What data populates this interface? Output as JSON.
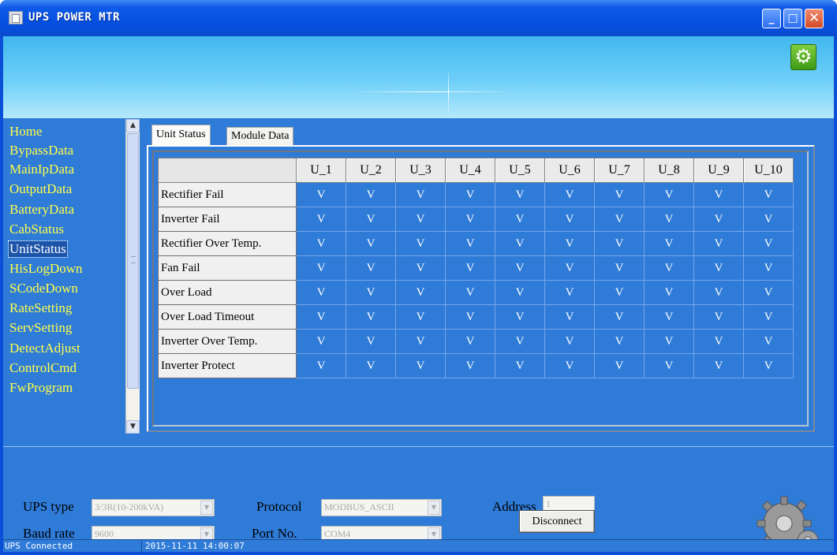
{
  "window": {
    "title": "UPS POWER MTR",
    "controls": {
      "minimize": "_",
      "maximize": "□",
      "close": "✕"
    }
  },
  "banner": {
    "settings_icon": "gear-icon"
  },
  "sidebar": {
    "items": [
      {
        "label": "Home",
        "selected": false
      },
      {
        "label": "BypassData",
        "selected": false
      },
      {
        "label": "MainIpData",
        "selected": false
      },
      {
        "label": "OutputData",
        "selected": false
      },
      {
        "label": "BatteryData",
        "selected": false
      },
      {
        "label": "CabStatus",
        "selected": false
      },
      {
        "label": "UnitStatus",
        "selected": true
      },
      {
        "label": "HisLogDown",
        "selected": false
      },
      {
        "label": "SCodeDown",
        "selected": false
      },
      {
        "label": "RateSetting",
        "selected": false
      },
      {
        "label": "ServSetting",
        "selected": false
      },
      {
        "label": "DetectAdjust",
        "selected": false
      },
      {
        "label": "ControlCmd",
        "selected": false
      },
      {
        "label": "FwProgram",
        "selected": false
      }
    ]
  },
  "tabs": [
    {
      "label": "Unit Status",
      "active": true
    },
    {
      "label": "Module Data",
      "active": false
    }
  ],
  "unit_table": {
    "columns": [
      "U_1",
      "U_2",
      "U_3",
      "U_4",
      "U_5",
      "U_6",
      "U_7",
      "U_8",
      "U_9",
      "U_10"
    ],
    "rows": [
      {
        "label": "Rectifier Fail",
        "values": [
          "V",
          "V",
          "V",
          "V",
          "V",
          "V",
          "V",
          "V",
          "V",
          "V"
        ]
      },
      {
        "label": "Inverter Fail",
        "values": [
          "V",
          "V",
          "V",
          "V",
          "V",
          "V",
          "V",
          "V",
          "V",
          "V"
        ]
      },
      {
        "label": "Rectifier Over Temp.",
        "values": [
          "V",
          "V",
          "V",
          "V",
          "V",
          "V",
          "V",
          "V",
          "V",
          "V"
        ]
      },
      {
        "label": "Fan Fail",
        "values": [
          "V",
          "V",
          "V",
          "V",
          "V",
          "V",
          "V",
          "V",
          "V",
          "V"
        ]
      },
      {
        "label": "Over Load",
        "values": [
          "V",
          "V",
          "V",
          "V",
          "V",
          "V",
          "V",
          "V",
          "V",
          "V"
        ]
      },
      {
        "label": "Over Load Timeout",
        "values": [
          "V",
          "V",
          "V",
          "V",
          "V",
          "V",
          "V",
          "V",
          "V",
          "V"
        ]
      },
      {
        "label": "Inverter Over Temp.",
        "values": [
          "V",
          "V",
          "V",
          "V",
          "V",
          "V",
          "V",
          "V",
          "V",
          "V"
        ]
      },
      {
        "label": "Inverter Protect",
        "values": [
          "V",
          "V",
          "V",
          "V",
          "V",
          "V",
          "V",
          "V",
          "V",
          "V"
        ]
      }
    ]
  },
  "settings": {
    "ups_type_label": "UPS type",
    "ups_type_value": "3/3R(10-200kVA)",
    "baud_rate_label": "Baud rate",
    "baud_rate_value": "9600",
    "protocol_label": "Protocol",
    "protocol_value": "MODBUS_ASCII",
    "port_label": "Port No.",
    "port_value": "COM4",
    "address_label": "Address",
    "address_value": "1",
    "disconnect_label": "Disconnect"
  },
  "status_bar": {
    "connection": "UPS Connected",
    "timestamp": "2015-11-11 14:00:07"
  }
}
